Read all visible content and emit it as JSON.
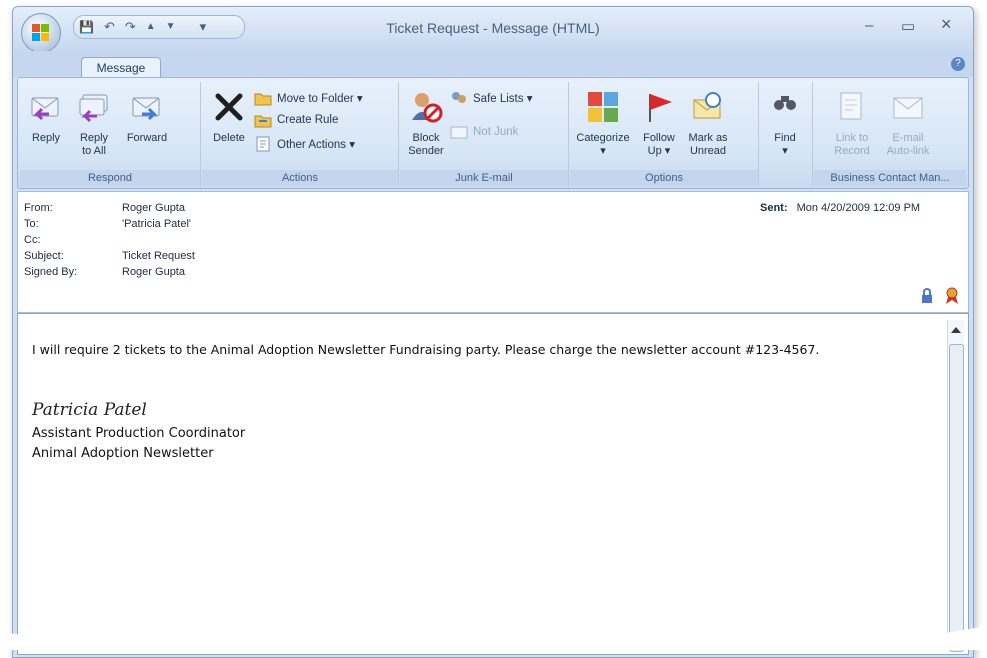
{
  "window": {
    "title": "Ticket Request - Message (HTML)",
    "controls": {
      "minimize": "–",
      "maximize": "▭",
      "close": "×"
    }
  },
  "quick_access": {
    "save": "💾",
    "undo": "↶",
    "redo": "↷",
    "up": "▲",
    "down": "▼",
    "customize": "▾"
  },
  "ribbon": {
    "tab": "Message",
    "help": "?",
    "groups": {
      "respond": {
        "label": "Respond",
        "reply": "Reply",
        "reply_all_1": "Reply",
        "reply_all_2": "to All",
        "forward": "Forward"
      },
      "actions": {
        "label": "Actions",
        "delete": "Delete",
        "move_to_folder": "Move to Folder ▾",
        "create_rule": "Create Rule",
        "other_actions": "Other Actions ▾"
      },
      "junk": {
        "label": "Junk E-mail",
        "block_sender_1": "Block",
        "block_sender_2": "Sender",
        "safe_lists": "Safe Lists ▾",
        "not_junk": "Not Junk"
      },
      "options": {
        "label": "Options",
        "categorize": "Categorize",
        "categorize_arrow": "▾",
        "follow_up_1": "Follow",
        "follow_up_2": "Up ▾",
        "mark_unread_1": "Mark as",
        "mark_unread_2": "Unread"
      },
      "find": {
        "find": "Find",
        "arrow": "▾"
      },
      "bcm": {
        "label": "Business Contact Man...",
        "link_record_1": "Link to",
        "link_record_2": "Record",
        "email_autolink_1": "E-mail",
        "email_autolink_2": "Auto-link"
      }
    }
  },
  "header": {
    "from_label": "From:",
    "from_value": "Roger Gupta",
    "to_label": "To:",
    "to_value": "'Patricia Patel'",
    "cc_label": "Cc:",
    "cc_value": "",
    "subject_label": "Subject:",
    "subject_value": "Ticket Request",
    "signed_label": "Signed By:",
    "signed_value": "Roger Gupta",
    "sent_label": "Sent:",
    "sent_value": "Mon 4/20/2009 12:09 PM"
  },
  "body": {
    "message": "I will require 2 tickets to the Animal Adoption Newsletter Fundraising party. Please charge the newsletter account #123-4567.",
    "signature_name": "Patricia Patel",
    "signature_title": "Assistant Production Coordinator",
    "signature_org": "Animal Adoption Newsletter"
  },
  "colors": {
    "window_frame": "#cfe0f4",
    "ribbon_label": "#3f5f8c",
    "title_text": "#4a5f7c"
  }
}
